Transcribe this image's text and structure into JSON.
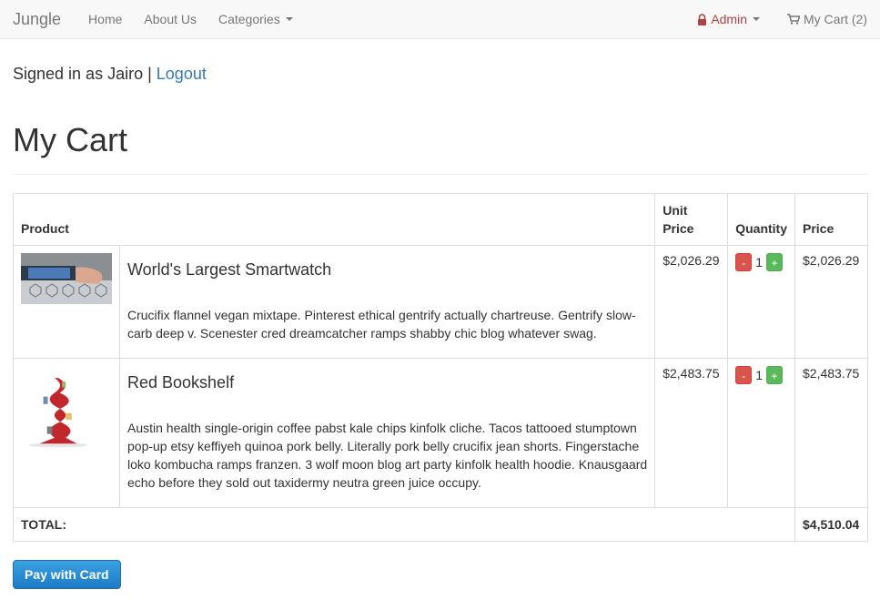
{
  "navbar": {
    "brand": "Jungle",
    "home": "Home",
    "about": "About Us",
    "categories": "Categories",
    "admin": "Admin",
    "cart": "My Cart (2)"
  },
  "session": {
    "signed_in_text": "Signed in as Jairo |",
    "logout": "Logout"
  },
  "page_title": "My Cart",
  "table": {
    "headers": {
      "product": "Product",
      "unit_price": "Unit Price",
      "quantity": "Quantity",
      "price": "Price"
    },
    "rows": [
      {
        "name": "World's Largest Smartwatch",
        "description": "Crucifix flannel vegan mixtape. Pinterest ethical gentrify actually chartreuse. Gentrify slow-carb deep v. Scenester cred dreamcatcher ramps shabby chic blog whatever swag.",
        "unit_price": "$2,026.29",
        "quantity": "1",
        "price": "$2,026.29",
        "minus": "-",
        "plus": "+"
      },
      {
        "name": "Red Bookshelf",
        "description": "Austin health single-origin coffee pabst kale chips kinfolk cliche. Tacos tattooed stumptown pop-up etsy keffiyeh quinoa pork belly. Literally pork belly crucifix jean shorts. Fingerstache loko kombucha ramps franzen. 3 wolf moon blog art party kinfolk health hoodie. Knausgaard echo before they sold out taxidermy neutra green juice occupy.",
        "unit_price": "$2,483.75",
        "quantity": "1",
        "price": "$2,483.75",
        "minus": "-",
        "plus": "+"
      }
    ],
    "total_label": "TOTAL:",
    "total_value": "$4,510.04"
  },
  "pay_button": "Pay with Card",
  "colors": {
    "link": "#337ab7",
    "admin": "#a94442",
    "minus_button": "#d9534f",
    "plus_button": "#5cb85c",
    "pay_button": "#1d7ac6"
  },
  "icons": [
    "lock-icon",
    "shopping-cart-icon",
    "caret-down-icon",
    "minus-icon",
    "plus-icon"
  ]
}
